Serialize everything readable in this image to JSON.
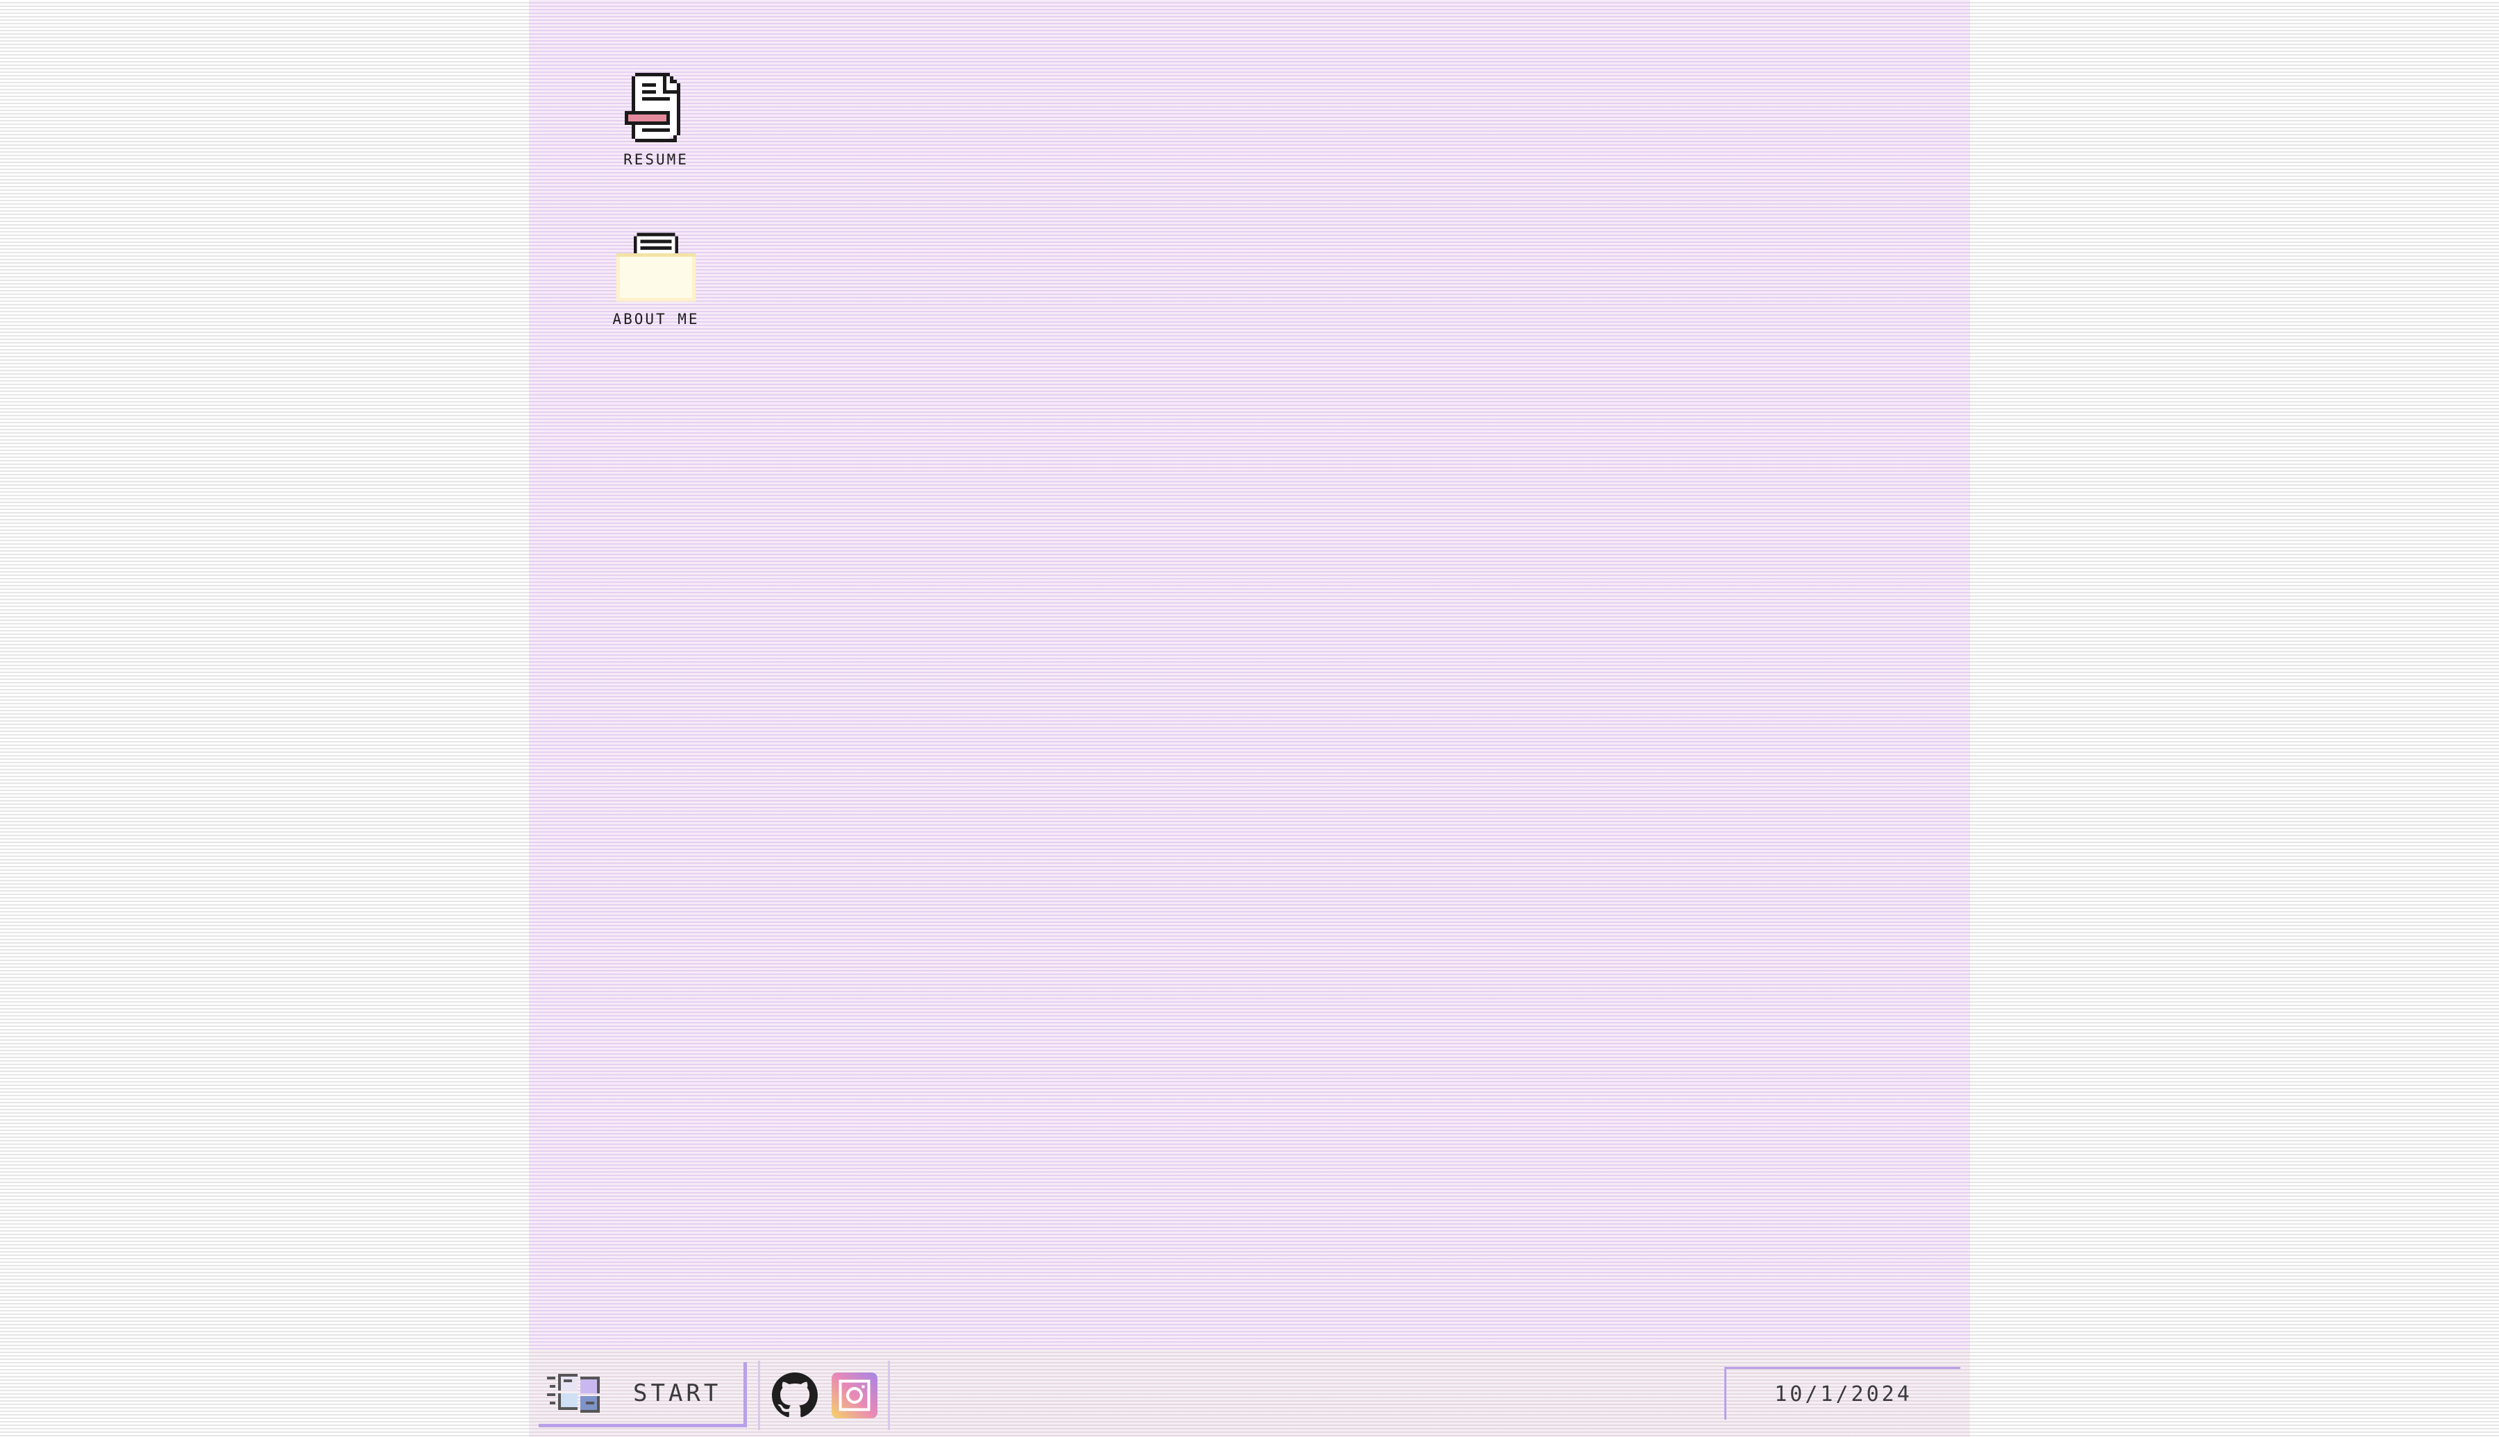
{
  "desktop": {
    "icons": [
      {
        "label": "RESUME",
        "icon": "resume-document-icon"
      },
      {
        "label": "ABOUT ME",
        "icon": "about-me-folder-icon"
      }
    ]
  },
  "taskbar": {
    "start_label": "START",
    "start_icon": "windows-logo-icon",
    "quick_launch": [
      {
        "icon": "github-icon"
      },
      {
        "icon": "instagram-icon"
      }
    ],
    "date": "10/1/2024"
  },
  "colors": {
    "desktop_background": "#f1e1f5",
    "taskbar_background": "#efe6ec",
    "accent_border": "#b9a0e8",
    "resume_accent": "#e58a9c",
    "folder_fill": "#fff8dc"
  }
}
